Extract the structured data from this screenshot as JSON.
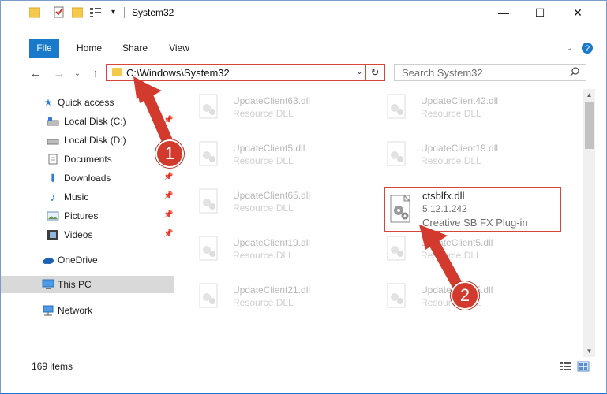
{
  "window": {
    "title": "System32",
    "controls": {
      "minimize": "—",
      "maximize": "☐",
      "close": "✕"
    }
  },
  "ribbon": {
    "tabs": [
      "File",
      "Home",
      "Share",
      "View"
    ],
    "help_icon": "help-icon",
    "collapse_icon": "chevron-down-icon"
  },
  "address_bar": {
    "path": "C:\\Windows\\System32",
    "dropdown": "⌄",
    "refresh": "↻"
  },
  "search": {
    "placeholder": "Search System32"
  },
  "nav": {
    "back": "←",
    "forward": "→",
    "recent": "⌄",
    "up": "↑"
  },
  "sidebar": {
    "items": [
      {
        "label": "Quick access",
        "icon": "star-icon",
        "pinned": false
      },
      {
        "label": "Local Disk (C:)",
        "icon": "drive-icon",
        "pinned": true
      },
      {
        "label": "Local Disk (D:)",
        "icon": "drive-icon",
        "pinned": false
      },
      {
        "label": "Documents",
        "icon": "documents-icon",
        "pinned": true
      },
      {
        "label": "Downloads",
        "icon": "download-icon",
        "pinned": true
      },
      {
        "label": "Music",
        "icon": "music-icon",
        "pinned": true
      },
      {
        "label": "Pictures",
        "icon": "pictures-icon",
        "pinned": true
      },
      {
        "label": "Videos",
        "icon": "videos-icon",
        "pinned": true
      },
      {
        "label": "OneDrive",
        "icon": "cloud-icon",
        "pinned": false
      },
      {
        "label": "This PC",
        "icon": "computer-icon",
        "pinned": false,
        "selected": true
      },
      {
        "label": "Network",
        "icon": "network-icon",
        "pinned": false
      }
    ]
  },
  "files": [
    {
      "name": "UpdateClient63.dll",
      "desc": "Resource DLL"
    },
    {
      "name": "UpdateClient42.dll",
      "desc": "Resource DLL"
    },
    {
      "name": "UpdateClient5.dll",
      "desc": "Resource DLL"
    },
    {
      "name": "UpdateClient19.dll",
      "desc": "Resource DLL"
    },
    {
      "name": "UpdateClient65.dll",
      "desc": "Resource DLL"
    },
    {
      "name": "UpdateClient19.dll",
      "desc": "Resource DLL"
    },
    {
      "name": "UpdateClient5.dll",
      "desc": "Resource DLL"
    },
    {
      "name": "UpdateClient21.dll",
      "desc": "Resource DLL"
    },
    {
      "name": "UpdateClient5.dll",
      "desc": "Resource DLL"
    }
  ],
  "highlighted_file": {
    "name": "ctsblfx.dll",
    "version": "5.12.1.242",
    "desc": "Creative SB FX Plug-in"
  },
  "status": {
    "item_count": "169 items"
  },
  "annotations": {
    "step1": "1",
    "step2": "2",
    "color": "#d33a2e"
  }
}
